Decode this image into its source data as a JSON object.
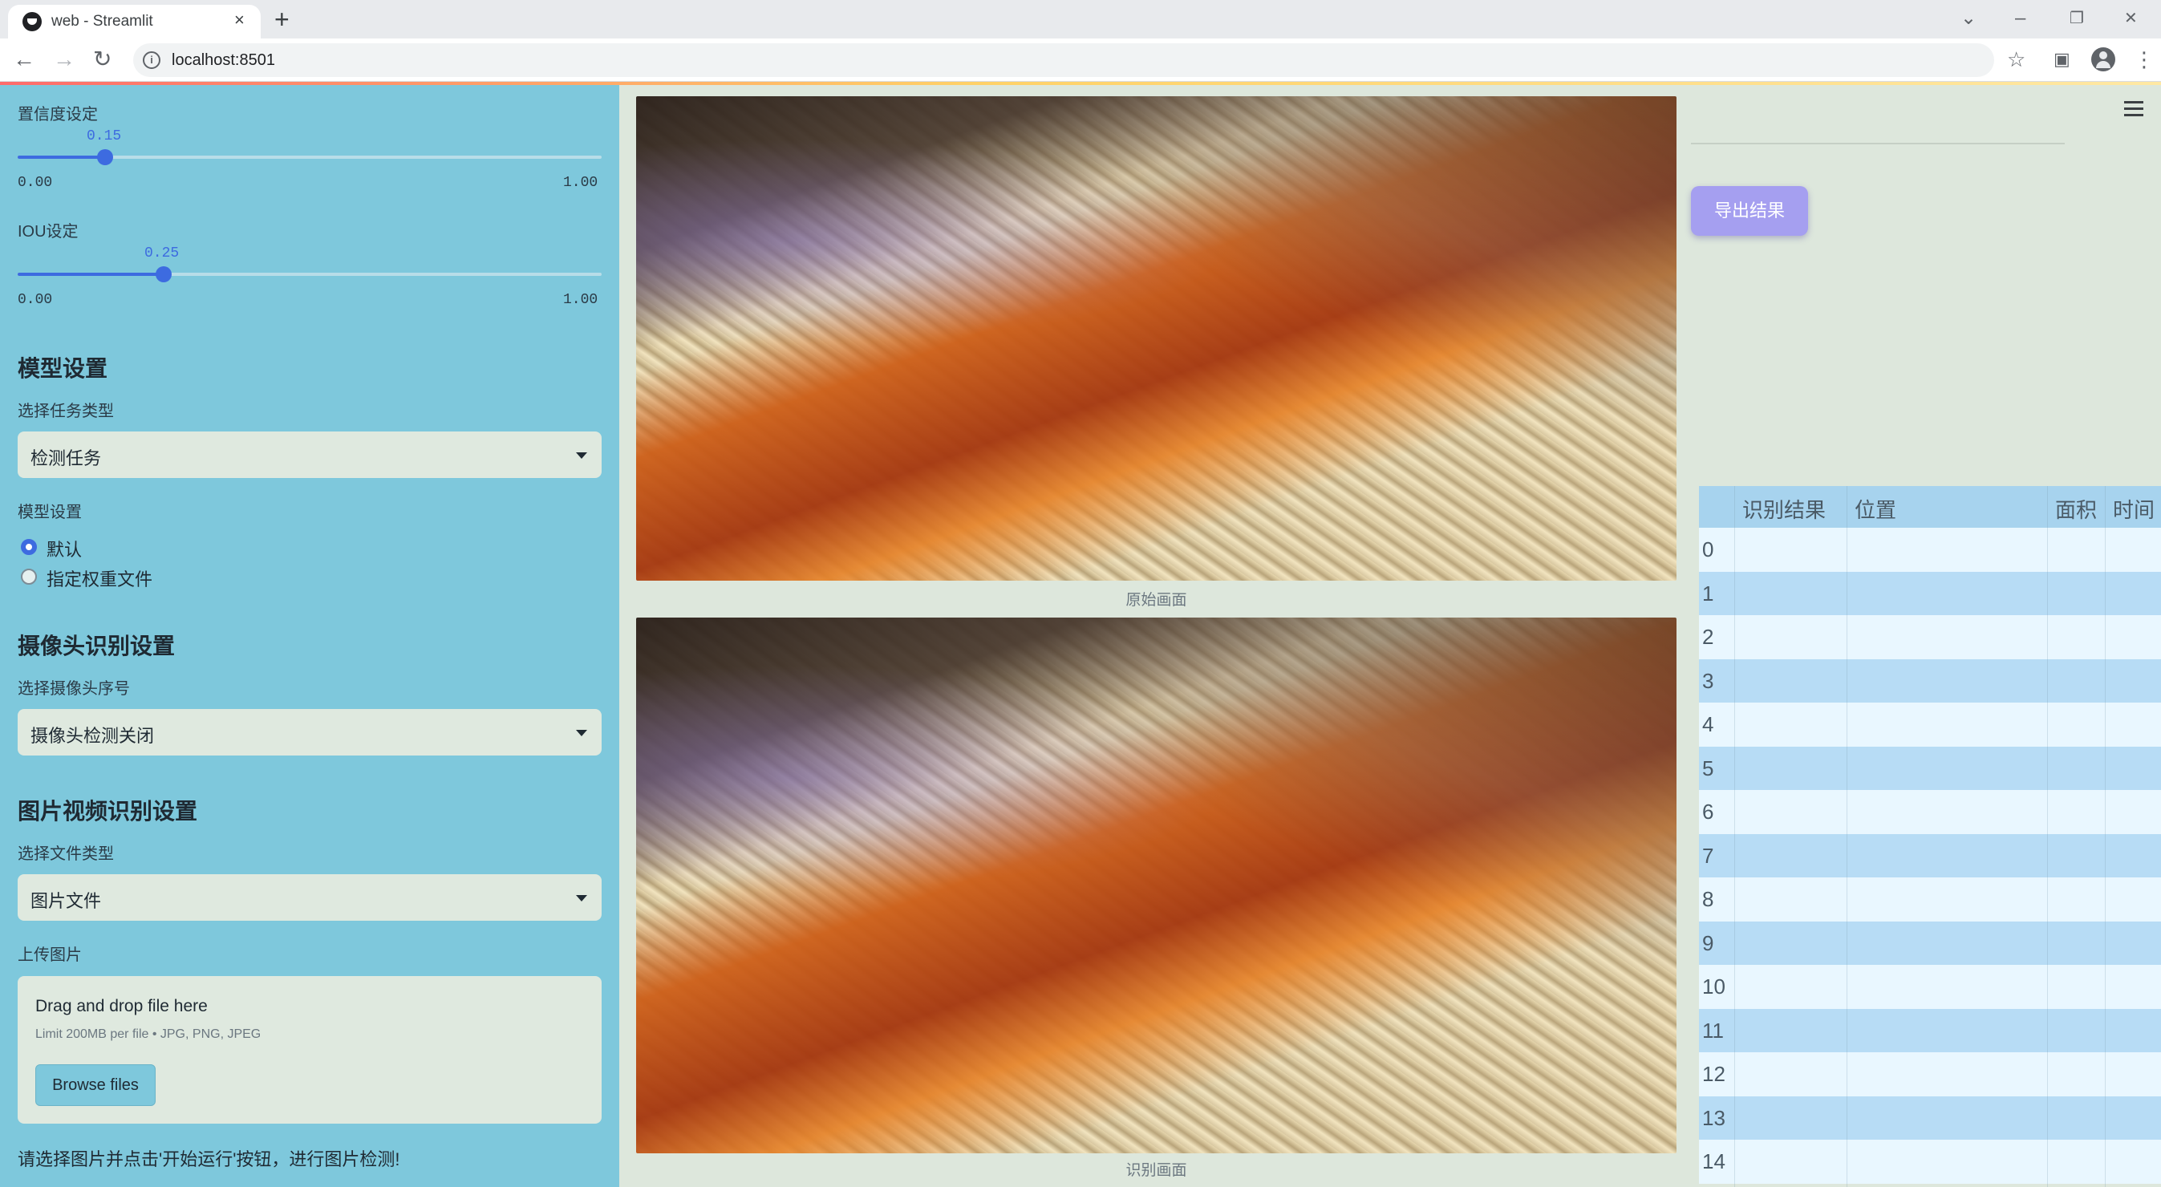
{
  "browser": {
    "tab_title": "web - Streamlit",
    "tab_close": "×",
    "new_tab": "+",
    "url": "localhost:8501",
    "nav_back": "←",
    "nav_forward": "→",
    "nav_reload": "↻",
    "star_icon": "☆",
    "sidepanel_icon": "▣",
    "menu_icon": "⋮",
    "win_dropdown": "⌄",
    "win_minimize": "–",
    "win_restore": "❐",
    "win_close": "✕"
  },
  "sidebar": {
    "confidence": {
      "label": "置信度设定",
      "value": "0.15",
      "value_fraction": 0.15,
      "min": "0.00",
      "max": "1.00"
    },
    "iou": {
      "label": "IOU设定",
      "value": "0.25",
      "value_fraction": 0.25,
      "min": "0.00",
      "max": "1.00"
    },
    "model_heading": "模型设置",
    "task_type_label": "选择任务类型",
    "task_type_value": "检测任务",
    "model_setting_label": "模型设置",
    "radio_default": "默认",
    "radio_custom": "指定权重文件",
    "camera_heading": "摄像头识别设置",
    "camera_label": "选择摄像头序号",
    "camera_value": "摄像头检测关闭",
    "media_heading": "图片视频识别设置",
    "file_type_label": "选择文件类型",
    "file_type_value": "图片文件",
    "upload_label": "上传图片",
    "dropzone_title": "Drag and drop file here",
    "dropzone_hint": "Limit 200MB per file • JPG, PNG, JPEG",
    "browse_button": "Browse files",
    "footer_text": "请选择图片并点击'开始运行'按钮，进行图片检测!"
  },
  "main": {
    "original_caption": "原始画面",
    "result_caption": "识别画面",
    "export_button": "导出结果"
  },
  "table": {
    "columns": [
      "识别结果",
      "位置",
      "面积",
      "时间"
    ],
    "row_indices": [
      "0",
      "1",
      "2",
      "3",
      "4",
      "5",
      "6",
      "7",
      "8",
      "9",
      "10",
      "11",
      "12",
      "13",
      "14"
    ]
  },
  "colors": {
    "sidebar_bg": "#7ec8dc",
    "accent": "#3d6be0",
    "export_button": "#a59ff0",
    "table_header": "#a7d3ee"
  }
}
